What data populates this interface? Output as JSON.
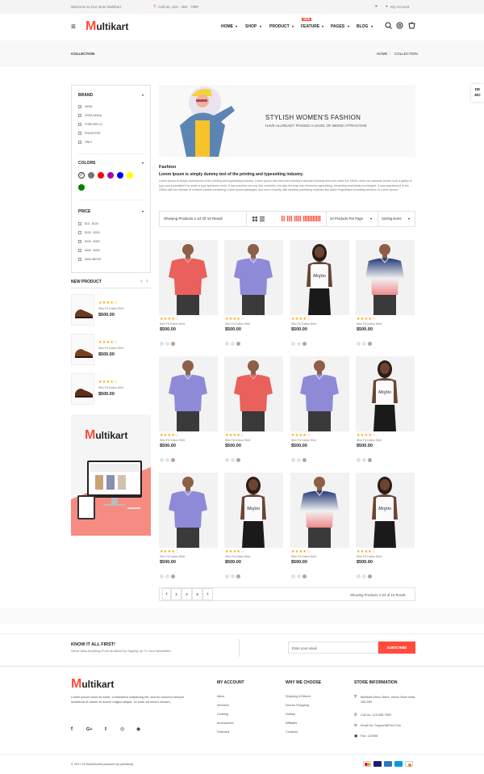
{
  "topbar": {
    "welcome": "Welcome to Our store Multikart",
    "call": "Call Us: 123 - 456 - 7890",
    "account": "My Account"
  },
  "brand": {
    "logo_m": "M",
    "logo_rest": "ultikart"
  },
  "nav": {
    "items": [
      "HOME",
      "SHOP",
      "PRODUCT",
      "FEATURE",
      "PAGES",
      "BLOG"
    ],
    "new_badge": "NEW"
  },
  "icons": {
    "menu": "menu-icon",
    "search": "search-icon",
    "settings": "gear-icon",
    "cart": "cart-icon",
    "heart": "heart-icon",
    "user": "user-icon"
  },
  "colors": {
    "accent": "#ff4c3b",
    "star": "#ffa200",
    "swatches": [
      "#ffffff",
      "#777777",
      "#ff0000",
      "#aa00aa",
      "#0000ff",
      "#ffff00",
      "#008000"
    ]
  },
  "breadcrumb": {
    "title": "COLLECTION",
    "home": "HOME",
    "sep": "/",
    "current": "COLLECTION"
  },
  "side_tab": {
    "l1": "DE",
    "l2": "MO"
  },
  "filters": {
    "brand_title": "BRAND",
    "brands": [
      "ZARA",
      "VERA-MODA",
      "FOREVER-21",
      "ROADSTER",
      "ONLY"
    ],
    "colors_title": "COLORS",
    "price_title": "PRICE",
    "prices": [
      "$10 - $100",
      "$100 - $200",
      "$200 - $300",
      "$300 - $400",
      "$400 ABOVE"
    ]
  },
  "new_product": {
    "title": "NEW PRODUCT",
    "prev": "‹",
    "next": "›",
    "items": [
      {
        "stars": "★★★★☆",
        "name": "Slim Fit Cotton Shirt",
        "price": "$500.00"
      },
      {
        "stars": "★★★★☆",
        "name": "Slim Fit Cotton Shirt",
        "price": "$500.00"
      },
      {
        "stars": "★★★★☆",
        "name": "Slim Fit Cotton Shirt",
        "price": "$500.00"
      }
    ]
  },
  "promo": {
    "logo_m": "M",
    "logo_rest": "ultikart"
  },
  "banner": {
    "title": "STYLISH WOMEN'S FASHION",
    "subtitle": "HAVE ALLREADY PASSED A LEVEL OF BEING ATTRACTIVE"
  },
  "intro": {
    "heading": "Fashion",
    "bold": "Lorem Ipsum is simply dummy text of the printing and typesetting industry.",
    "body": "Lorem Ipsum is simply dummy text of the printing and typesetting industry. Lorem Ipsum has been the industry's standard dummy text ever since the 1500s, when an unknown printer took a galley of type and scrambled it to make a type specimen book. It has survived not only five centuries, but also the leap into electronic typesetting, remaining essentially unchanged. It was popularised in the 1960s with the release of Letraset sheets containing Lorem Ipsum passages, and more recently with desktop publishing software like Aldus PageMaker including versions of Lorem Ipsum."
  },
  "toolbar": {
    "showing": "Showing Products 1-24 Of 10 Result",
    "per_page": "24 Products Par Page",
    "sort": "Sorting items"
  },
  "products": [
    {
      "type": "red-tee",
      "stars": "★★★★☆",
      "name": "Slim Fit Cotton Shirt",
      "price": "$500.00"
    },
    {
      "type": "purple-tee",
      "stars": "★★★★☆",
      "name": "Slim Fit Cotton Shirt",
      "price": "$500.00"
    },
    {
      "type": "woman-white",
      "stars": "★★★★☆",
      "name": "Slim Fit Cotton Shirt",
      "price": "$500.00"
    },
    {
      "type": "gradient-tee",
      "stars": "★★★★☆",
      "name": "Slim Fit Cotton Shirt",
      "price": "$500.00"
    },
    {
      "type": "purple-tee",
      "stars": "★★★★☆",
      "name": "Slim Fit Cotton Shirt",
      "price": "$500.00"
    },
    {
      "type": "red-tee",
      "stars": "★★★★☆",
      "name": "Slim Fit Cotton Shirt",
      "price": "$500.00"
    },
    {
      "type": "purple-tee",
      "stars": "★★★★☆",
      "name": "Slim Fit Cotton Shirt",
      "price": "$500.00"
    },
    {
      "type": "woman-white",
      "stars": "★★★★☆",
      "name": "Slim Fit Cotton Shirt",
      "price": "$500.00"
    },
    {
      "type": "purple-tee",
      "stars": "★★★★☆",
      "name": "Slim Fit Cotton Shirt",
      "price": "$500.00"
    },
    {
      "type": "woman-white",
      "stars": "★★★★☆",
      "name": "Slim Fit Cotton Shirt",
      "price": "$500.00"
    },
    {
      "type": "gradient-tee",
      "stars": "★★★★☆",
      "name": "Slim Fit Cotton Shirt",
      "price": "$500.00"
    },
    {
      "type": "woman-white",
      "stars": "★★★★☆",
      "name": "Slim Fit Cotton Shirt",
      "price": "$500.00"
    }
  ],
  "pagination": {
    "prev": "‹",
    "pages": [
      "1",
      "2",
      "3"
    ],
    "next": "›",
    "summary": "Showing Products 1-24 of 10 Result"
  },
  "newsletter": {
    "title": "KNOW IT ALL FIRST!",
    "subtitle": "Never Miss Anything From Multikart By Signing Up To Your Newsletter.",
    "placeholder": "Enter your email",
    "button": "SUBSCRIBE"
  },
  "footer": {
    "about": "Lorem ipsum dolor sit amet, consectetur adipiscing elit, sed do eiusmod tempor incididunt ut labore et dolore magna aliqua. Ut enim ad minim veniam,",
    "social": [
      "f",
      "G+",
      "t",
      "◎",
      "◉"
    ],
    "my_account_title": "MY ACCOUNT",
    "my_account": [
      "Mens",
      "Womens",
      "Clothing",
      "Accessories",
      "Featured"
    ],
    "why_title": "WHY WE CHOOSE",
    "why": [
      "Shipping & Return",
      "Secure Shopping",
      "Gallary",
      "Affiliates",
      "Contacts"
    ],
    "store_title": "STORE INFORMATION",
    "store": [
      "Multikart Demo Store, Demo Store India 345-659",
      "Call Us: 123-456-7890",
      "Email Us: Support@Fiot.Com",
      "Fax: 123456"
    ],
    "copyright": "© 2017-18 themeforest powered by pixelstrap"
  }
}
